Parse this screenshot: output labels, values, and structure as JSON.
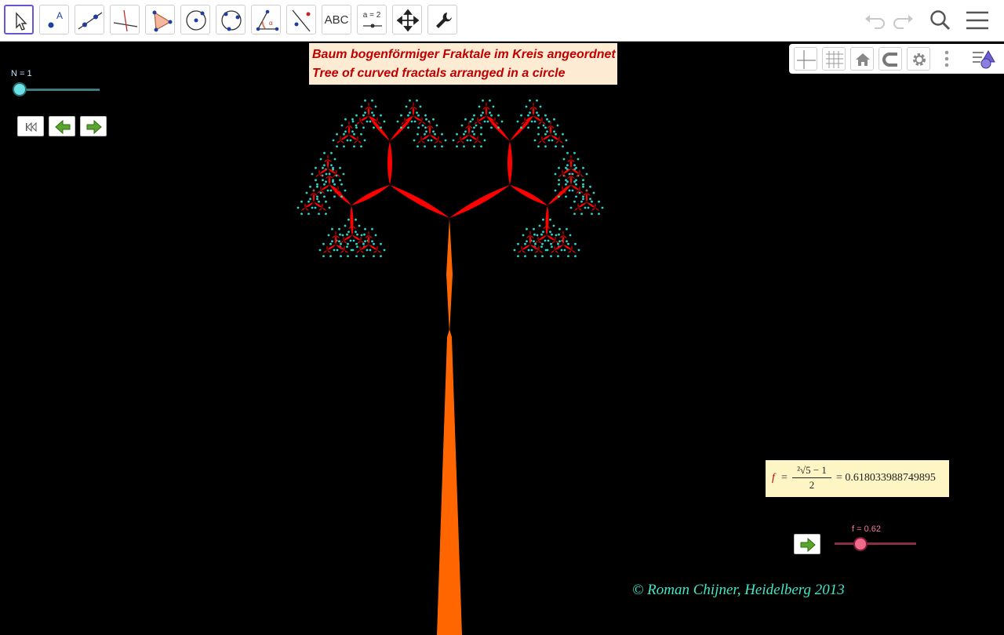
{
  "toolbar": {
    "tools": [
      {
        "name": "move-tool",
        "icon": "arrow-pointer-icon"
      },
      {
        "name": "point-tool",
        "icon": "point-icon"
      },
      {
        "name": "line-tool",
        "icon": "line-icon"
      },
      {
        "name": "perpendicular-line-tool",
        "icon": "perpendicular-icon"
      },
      {
        "name": "polygon-tool",
        "icon": "polygon-icon"
      },
      {
        "name": "circle-center-point-tool",
        "icon": "circle-icon"
      },
      {
        "name": "circle-three-points-tool",
        "icon": "ellipse-icon"
      },
      {
        "name": "angle-tool",
        "icon": "angle-icon"
      },
      {
        "name": "reflect-tool",
        "icon": "reflect-icon"
      },
      {
        "name": "text-tool",
        "label": "ABC"
      },
      {
        "name": "slider-tool",
        "label": "a = 2"
      },
      {
        "name": "move-graphics-view-tool",
        "icon": "move-arrows-icon"
      },
      {
        "name": "tools-settings",
        "icon": "wrench-icon"
      }
    ]
  },
  "title": {
    "line1": "Baum bogenförmiger Fraktale im Kreis angeordnet",
    "line2": "Tree of curved fractals arranged in a circle"
  },
  "slider_n": {
    "label": "N = 1",
    "value": 1
  },
  "formula": {
    "variable": "f",
    "equals": "=",
    "numerator": "²√5 − 1",
    "denominator": "2",
    "result": "= 0.618033988749895"
  },
  "slider_f": {
    "label": "f = 0.62",
    "value": 0.62
  },
  "copyright": "© Roman Chijner, Heidelberg 2013",
  "colors": {
    "trunk": "#ff6600",
    "branches": "#ff0000",
    "leaves": "#2fd4c8",
    "title_text": "#c00000",
    "title_bg": "#fdebd3",
    "formula_bg": "#fdf6c4"
  }
}
